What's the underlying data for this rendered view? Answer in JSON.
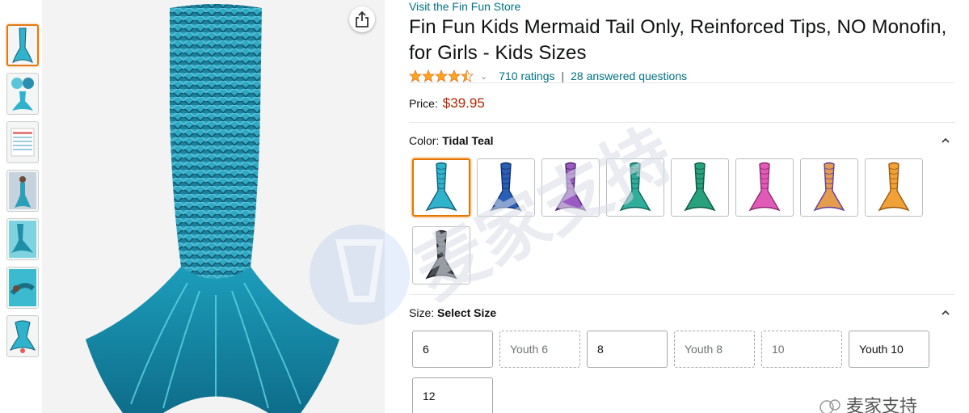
{
  "store": {
    "link_text": "Visit the Fin Fun Store"
  },
  "product": {
    "title": "Fin Fun Kids Mermaid Tail Only, Reinforced Tips, NO Monofin, for Girls - Kids Sizes",
    "rating_stars": 4.5,
    "ratings_text": "710 ratings",
    "separator": "|",
    "questions_text": "28 answered questions",
    "price_label": "Price:",
    "price": "$39.95"
  },
  "color": {
    "label": "Color:",
    "selected": "Tidal Teal",
    "swatches": [
      {
        "name": "tidal-teal",
        "fill": "#2fb3cc",
        "accent": "#155f79"
      },
      {
        "name": "royal-blue",
        "fill": "#2a5fb8",
        "accent": "#15306b"
      },
      {
        "name": "purple",
        "fill": "#9a5bc2",
        "accent": "#4d2a6e"
      },
      {
        "name": "aqua-green",
        "fill": "#2fae9c",
        "accent": "#13645a"
      },
      {
        "name": "emerald",
        "fill": "#27a27d",
        "accent": "#0f5a44"
      },
      {
        "name": "pink",
        "fill": "#e05bb5",
        "accent": "#8f2b72"
      },
      {
        "name": "rainbow",
        "fill": "#e59c4d",
        "accent": "#5f3f9c"
      },
      {
        "name": "gold",
        "fill": "#f0a236",
        "accent": "#9b5a12"
      },
      {
        "name": "black",
        "fill": "#4a4f55",
        "accent": "#15181b"
      }
    ]
  },
  "size": {
    "label": "Size:",
    "selected": "Select Size",
    "options": [
      {
        "label": "6",
        "available": true
      },
      {
        "label": "Youth 6",
        "available": false
      },
      {
        "label": "8",
        "available": true
      },
      {
        "label": "Youth 8",
        "available": false
      },
      {
        "label": "10",
        "available": false
      },
      {
        "label": "Youth 10",
        "available": true
      },
      {
        "label": "12",
        "available": true
      }
    ]
  },
  "watermark": {
    "text": "麦家支持",
    "corner_text": "麦家支持"
  },
  "colors": {
    "accent": "#007185",
    "price": "#b12704",
    "star": "#ffa41c",
    "selected_border": "#e77600"
  }
}
